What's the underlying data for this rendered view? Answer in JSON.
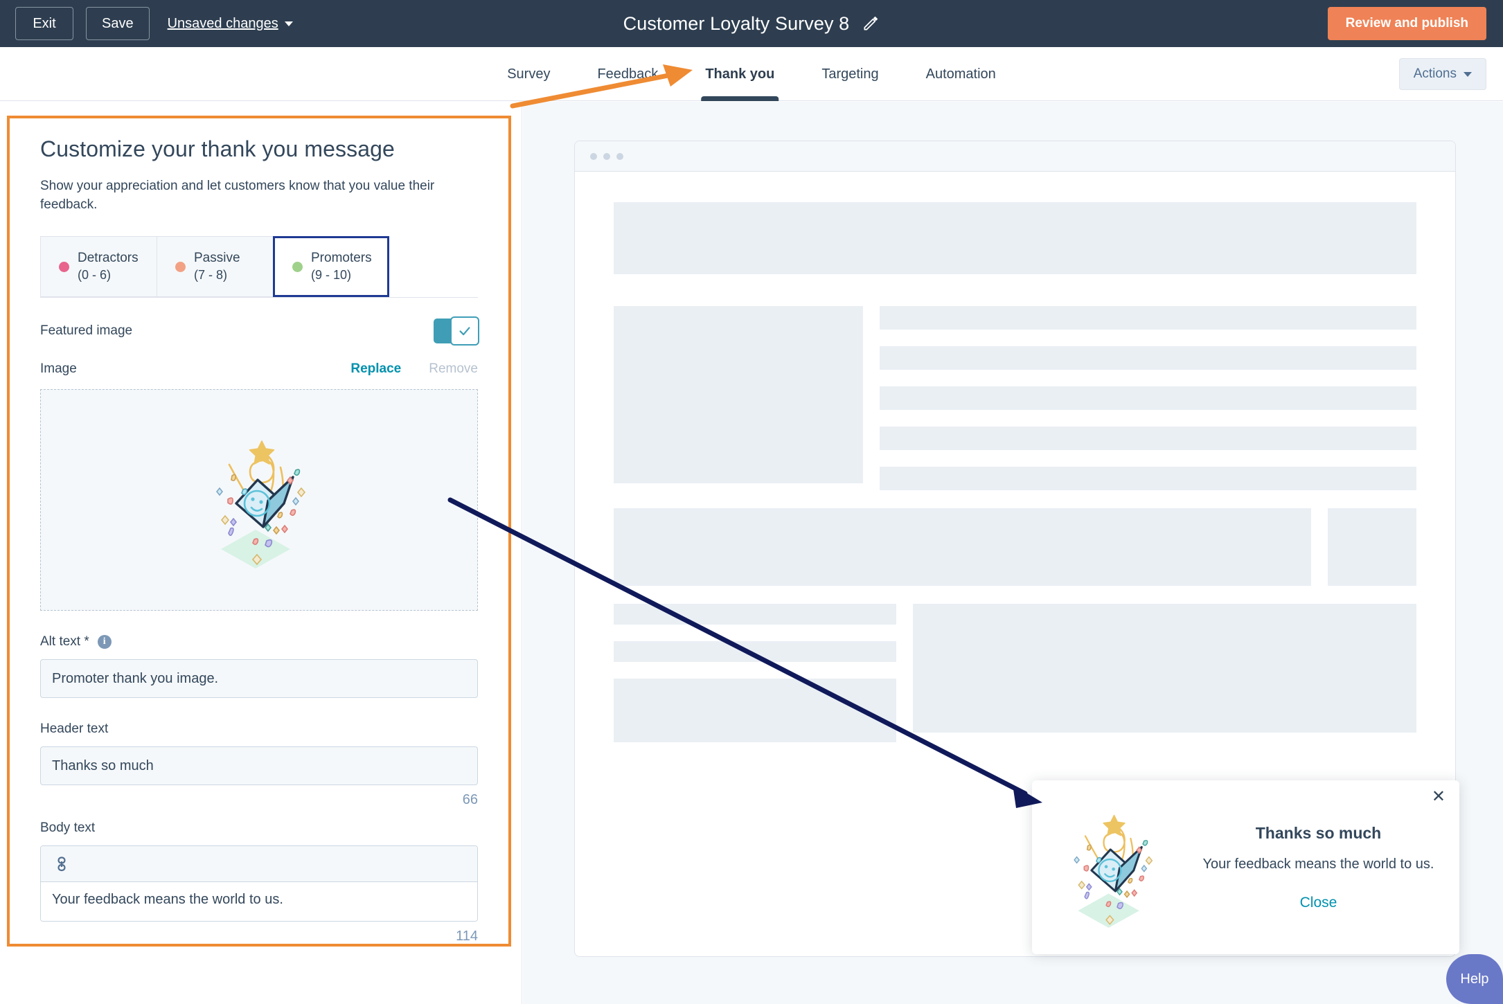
{
  "topbar": {
    "exit_label": "Exit",
    "save_label": "Save",
    "status_label": "Unsaved changes",
    "title": "Customer Loyalty Survey 8",
    "publish_label": "Review and publish"
  },
  "tabs": [
    {
      "label": "Survey",
      "active": false
    },
    {
      "label": "Feedback",
      "active": false
    },
    {
      "label": "Thank you",
      "active": true
    },
    {
      "label": "Targeting",
      "active": false
    },
    {
      "label": "Automation",
      "active": false
    }
  ],
  "actions": {
    "label": "Actions"
  },
  "left_panel": {
    "title": "Customize your thank you message",
    "subtitle": "Show your appreciation and let customers know that you value their feedback.",
    "segments": [
      {
        "name": "Detractors",
        "range": "(0 - 6)",
        "color": "#e8648c",
        "selected": false
      },
      {
        "name": "Passive",
        "range": "(7 - 8)",
        "color": "#f2a184",
        "selected": false
      },
      {
        "name": "Promoters",
        "range": "(9 - 10)",
        "color": "#9fd18b",
        "selected": true
      }
    ],
    "featured_image_label": "Featured image",
    "featured_image_on": true,
    "image_label": "Image",
    "replace_label": "Replace",
    "remove_label": "Remove",
    "alt_text_label": "Alt text *",
    "alt_text_value": "Promoter thank you image.",
    "header_text_label": "Header text",
    "header_text_value": "Thanks so much",
    "header_counter": "66",
    "body_text_label": "Body text",
    "body_text_value": "Your feedback means the world to us.",
    "body_counter": "114",
    "rte_icon": "link-icon"
  },
  "preview": {
    "thank_you": {
      "header": "Thanks so much",
      "body": "Your feedback means the world to us.",
      "close_label": "Close",
      "close_icon": "close-icon"
    }
  },
  "help": {
    "label": "Help"
  },
  "colors": {
    "topbar_bg": "#2e3e50",
    "accent_orange": "#ef8256",
    "highlight_border": "#ef8b33",
    "annotation_arrow_orange": "#ef8b33",
    "annotation_arrow_navy": "#101a5a",
    "link_teal": "#0091ae",
    "toggle_on": "#3f9eb6",
    "selected_tab_border": "#1f3a93",
    "help_purple": "#6a78c8",
    "skeleton": "#eaeff4",
    "panel_bg": "#f5f8fa"
  }
}
